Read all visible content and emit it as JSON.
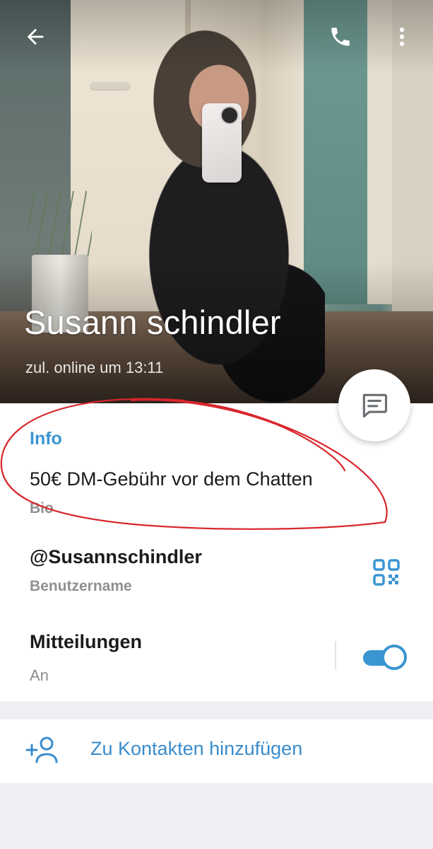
{
  "header": {
    "name": "Susann schindler",
    "status": "zul. online um 13:11",
    "back_icon": "arrow-left-icon",
    "call_icon": "phone-icon",
    "more_icon": "more-vertical-icon",
    "fab_icon": "message-icon"
  },
  "info": {
    "title": "Info",
    "bio": {
      "value": "50€ DM-Gebühr vor dem Chatten",
      "label": "Bio"
    },
    "username": {
      "value": "@Susannschindler",
      "label": "Benutzername",
      "icon": "qr-code-icon"
    },
    "notifications": {
      "value": "Mitteilungen",
      "label": "An",
      "enabled": true
    }
  },
  "actions": {
    "add_contact_label": "Zu Kontakten hinzufügen",
    "add_contact_icon": "add-user-icon"
  },
  "colors": {
    "accent": "#3a95d1",
    "annotation": "#d8262d",
    "background": "#efeff3"
  }
}
